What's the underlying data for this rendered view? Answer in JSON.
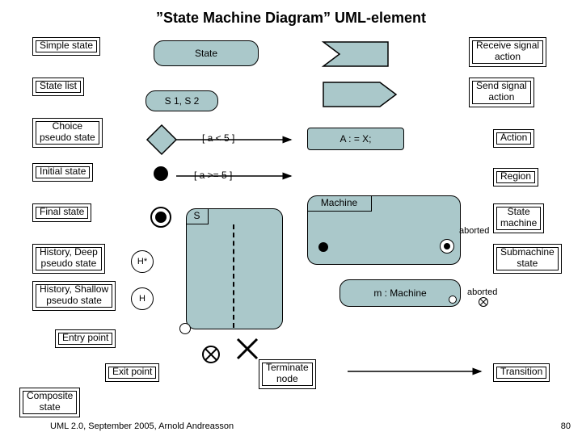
{
  "title": "”State Machine Diagram” UML-element",
  "labels": {
    "simple_state": "Simple state",
    "state_list": "State list",
    "choice": "Choice\npseudo state",
    "initial": "Initial state",
    "final": "Final state",
    "hist_deep": "History, Deep\npseudo state",
    "hist_shallow": "History, Shallow\npseudo state",
    "entry_point": "Entry point",
    "exit_point": "Exit point",
    "composite": "Composite\nstate",
    "terminate": "Terminate\nnode",
    "receive_signal": "Receive signal\naction",
    "send_signal": "Send signal\naction",
    "action": "Action",
    "region": "Region",
    "state_machine": "State\nmachine",
    "submachine": "Submachine\nstate",
    "transition": "Transition",
    "aborted1": "aborted",
    "aborted2": "aborted"
  },
  "shapes": {
    "state": "State",
    "s1s2": "S 1, S 2",
    "guard1": "[ a < 5 ]",
    "guard2": "[ a >= 5 ]",
    "action_box": "A : = X;",
    "svar": "S",
    "hstar": "H*",
    "h": "H",
    "machine": "Machine",
    "submachine": "m : Machine"
  },
  "footer": "UML 2.0, September 2005, Arnold Andreasson",
  "page": "80"
}
